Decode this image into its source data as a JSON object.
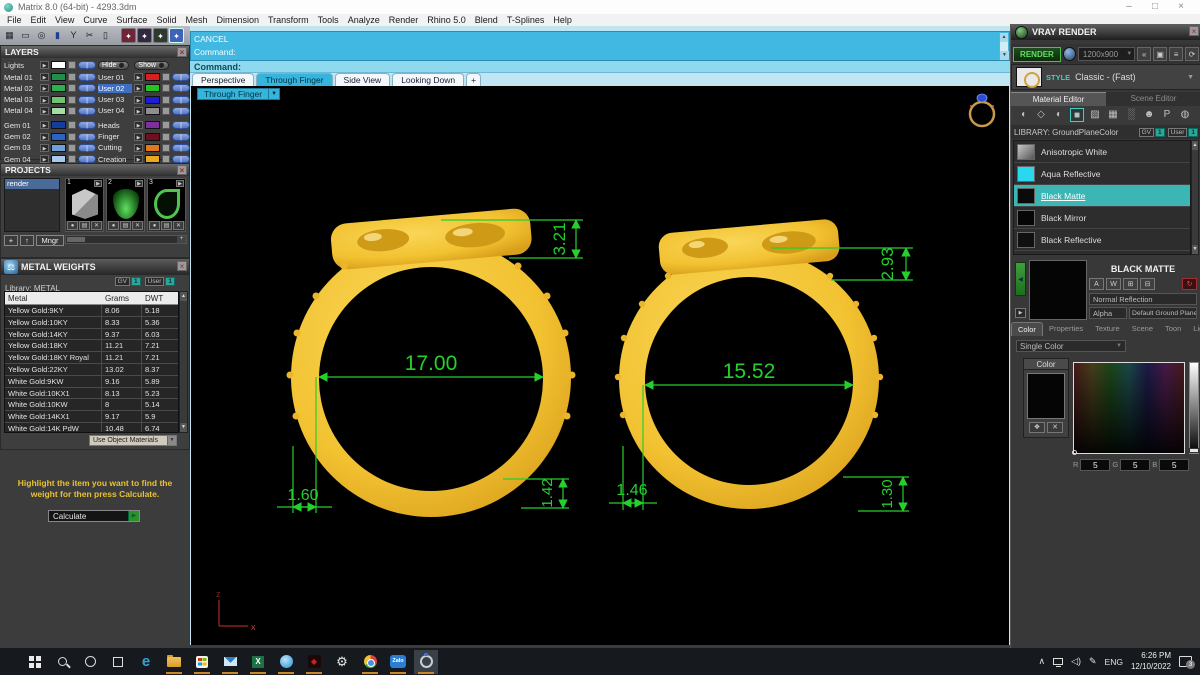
{
  "window": {
    "title": "Matrix 8.0 (64-bit) - 4293.3dm",
    "minimize": "–",
    "maximize": "□",
    "close": "×"
  },
  "menu": [
    "File",
    "Edit",
    "View",
    "Curve",
    "Surface",
    "Solid",
    "Mesh",
    "Dimension",
    "Transform",
    "Tools",
    "Analyze",
    "Render",
    "Rhino 5.0",
    "Blend",
    "T-Splines",
    "Help"
  ],
  "command": {
    "history": [
      "CANCEL",
      "Command:"
    ],
    "prompt": "Command:"
  },
  "viewport": {
    "tabs": [
      {
        "label": "Perspective",
        "active": false
      },
      {
        "label": "Through Finger",
        "active": true
      },
      {
        "label": "Side View",
        "active": false
      },
      {
        "label": "Looking Down",
        "active": false
      },
      {
        "label": "+",
        "active": false
      }
    ],
    "view_label": "Through Finger",
    "axis": {
      "x": "x",
      "z": "z"
    },
    "dimensions": {
      "left_ring": {
        "diameter": "17.00",
        "top": "3.21",
        "bottom_left": "1.60",
        "bottom_right": "1.42"
      },
      "right_ring": {
        "diameter": "15.52",
        "top": "2.93",
        "bottom_left": "1.46",
        "bottom_right": "1.30"
      }
    },
    "colors": {
      "gold": "#f1c233",
      "dim_green": "#25d02c"
    }
  },
  "layers": {
    "title": "LAYERS",
    "lights_label": "Lights",
    "hide_label": "Hide",
    "show_label": "Show",
    "left": [
      {
        "label": "Metal 01",
        "color": "#1f8f4a"
      },
      {
        "label": "Metal 02",
        "color": "#2fae4f"
      },
      {
        "label": "Metal 03",
        "color": "#6fc46f"
      },
      {
        "label": "Metal 04",
        "color": "#a5dba5"
      },
      {
        "label": "Gem 01",
        "color": "#123f9e"
      },
      {
        "label": "Gem 02",
        "color": "#2b63c4"
      },
      {
        "label": "Gem 03",
        "color": "#6f9fd8"
      },
      {
        "label": "Gem 04",
        "color": "#a9c9ec"
      }
    ],
    "right": [
      {
        "label": "User 01",
        "color": "#d42020"
      },
      {
        "label": "User 02",
        "color": "#22c522",
        "selected": true
      },
      {
        "label": "User 03",
        "color": "#1d1dd4"
      },
      {
        "label": "User 04",
        "color": "#8f8f8f"
      },
      {
        "label": "Heads",
        "color": "#7d2f9e"
      },
      {
        "label": "Finger",
        "color": "#6f1020"
      },
      {
        "label": "Cutting",
        "color": "#e07820"
      },
      {
        "label": "Creation",
        "color": "#e8a81f"
      }
    ]
  },
  "projects": {
    "title": "PROJECTS",
    "list": [
      "render"
    ],
    "buttons": [
      "+",
      "↑",
      "Mngr"
    ],
    "thumbnails": [
      {
        "index": "1"
      },
      {
        "index": "2"
      },
      {
        "index": "3"
      }
    ]
  },
  "metal_weights": {
    "title": "METAL WEIGHTS",
    "library_label": "Library: METAL",
    "toggles": {
      "gv": "GV",
      "gv_value": "1",
      "user": "User",
      "user_value": "1"
    },
    "columns": [
      "Metal",
      "Grams",
      "DWT"
    ],
    "rows": [
      [
        "Yellow Gold:9KY",
        "8.06",
        "5.18"
      ],
      [
        "Yellow Gold:10KY",
        "8.33",
        "5.36"
      ],
      [
        "Yellow Gold:14KY",
        "9.37",
        "6.03"
      ],
      [
        "Yellow Gold:18KY",
        "11.21",
        "7.21"
      ],
      [
        "Yellow Gold:18KY Royal",
        "11.21",
        "7.21"
      ],
      [
        "Yellow Gold:22KY",
        "13.02",
        "8.37"
      ],
      [
        "White Gold:9KW",
        "9.16",
        "5.89"
      ],
      [
        "White Gold:10KX1",
        "8.13",
        "5.23"
      ],
      [
        "White Gold:10KW",
        "8",
        "5.14"
      ],
      [
        "White Gold:14KX1",
        "9.17",
        "5.9"
      ],
      [
        "White Gold:14K PdW",
        "10.48",
        "6.74"
      ]
    ],
    "materials_dropdown": "Use Object Materials",
    "instruction": "Highlight the item you want to find the weight for then press Calculate.",
    "calculate_label": "Calculate"
  },
  "vray": {
    "title": "VRAY RENDER",
    "render_button": "RENDER",
    "resolution": "1200x900",
    "style_label": "STYLE",
    "style_value": "Classic - (Fast)",
    "tabs": [
      {
        "label": "Material Editor",
        "active": true
      },
      {
        "label": "Scene Editor",
        "active": false
      }
    ],
    "library_label": "LIBRARY: GroundPlaneColor",
    "toggles": {
      "gv": "GV",
      "gv_value": "1",
      "user": "User",
      "user_value": "1"
    },
    "materials": [
      {
        "name": "Anisotropic White",
        "swatch": "#9a9a9a",
        "selected": false
      },
      {
        "name": "Aqua Reflective",
        "swatch": "#29d7ee",
        "selected": false
      },
      {
        "name": "Black Matte",
        "swatch": "#0b0b0b",
        "selected": true
      },
      {
        "name": "Black Mirror",
        "swatch": "#060606",
        "selected": false
      },
      {
        "name": "Black Reflective",
        "swatch": "#101010",
        "selected": false
      },
      {
        "name": "",
        "swatch": "#1a1ae0",
        "selected": false
      }
    ],
    "detail": {
      "name": "BLACK MATTE",
      "reflection_dropdown": "Normal Reflection",
      "alpha_label": "Alpha",
      "ground_plane": "Default Ground Plane",
      "tabs": [
        {
          "label": "Color",
          "active": true
        },
        {
          "label": "Properties",
          "active": false
        },
        {
          "label": "Texture",
          "active": false
        },
        {
          "label": "Scene",
          "active": false
        },
        {
          "label": "Toon",
          "active": false
        },
        {
          "label": "Light",
          "active": false
        }
      ],
      "mode_dropdown": "Single Color",
      "color_label": "Color",
      "rgb": [
        {
          "label": "R",
          "value": "5"
        },
        {
          "label": "G",
          "value": "5"
        },
        {
          "label": "B",
          "value": "5"
        }
      ]
    }
  },
  "taskbar": {
    "icons": [
      {
        "name": "start"
      },
      {
        "name": "search"
      },
      {
        "name": "cortana"
      },
      {
        "name": "task-view"
      },
      {
        "name": "edge"
      },
      {
        "name": "file-explorer",
        "open": true
      },
      {
        "name": "store",
        "open": true
      },
      {
        "name": "mail",
        "open": true
      },
      {
        "name": "excel",
        "open": true
      },
      {
        "name": "app-blue",
        "open": true
      },
      {
        "name": "app-red",
        "open": true
      },
      {
        "name": "settings"
      },
      {
        "name": "chrome",
        "open": true
      },
      {
        "name": "zalo",
        "open": true
      },
      {
        "name": "matrix",
        "open": true,
        "active": true
      }
    ],
    "tray": {
      "language": "ENG",
      "time": "6:26 PM",
      "date": "12/10/2022",
      "badge": "3"
    }
  }
}
